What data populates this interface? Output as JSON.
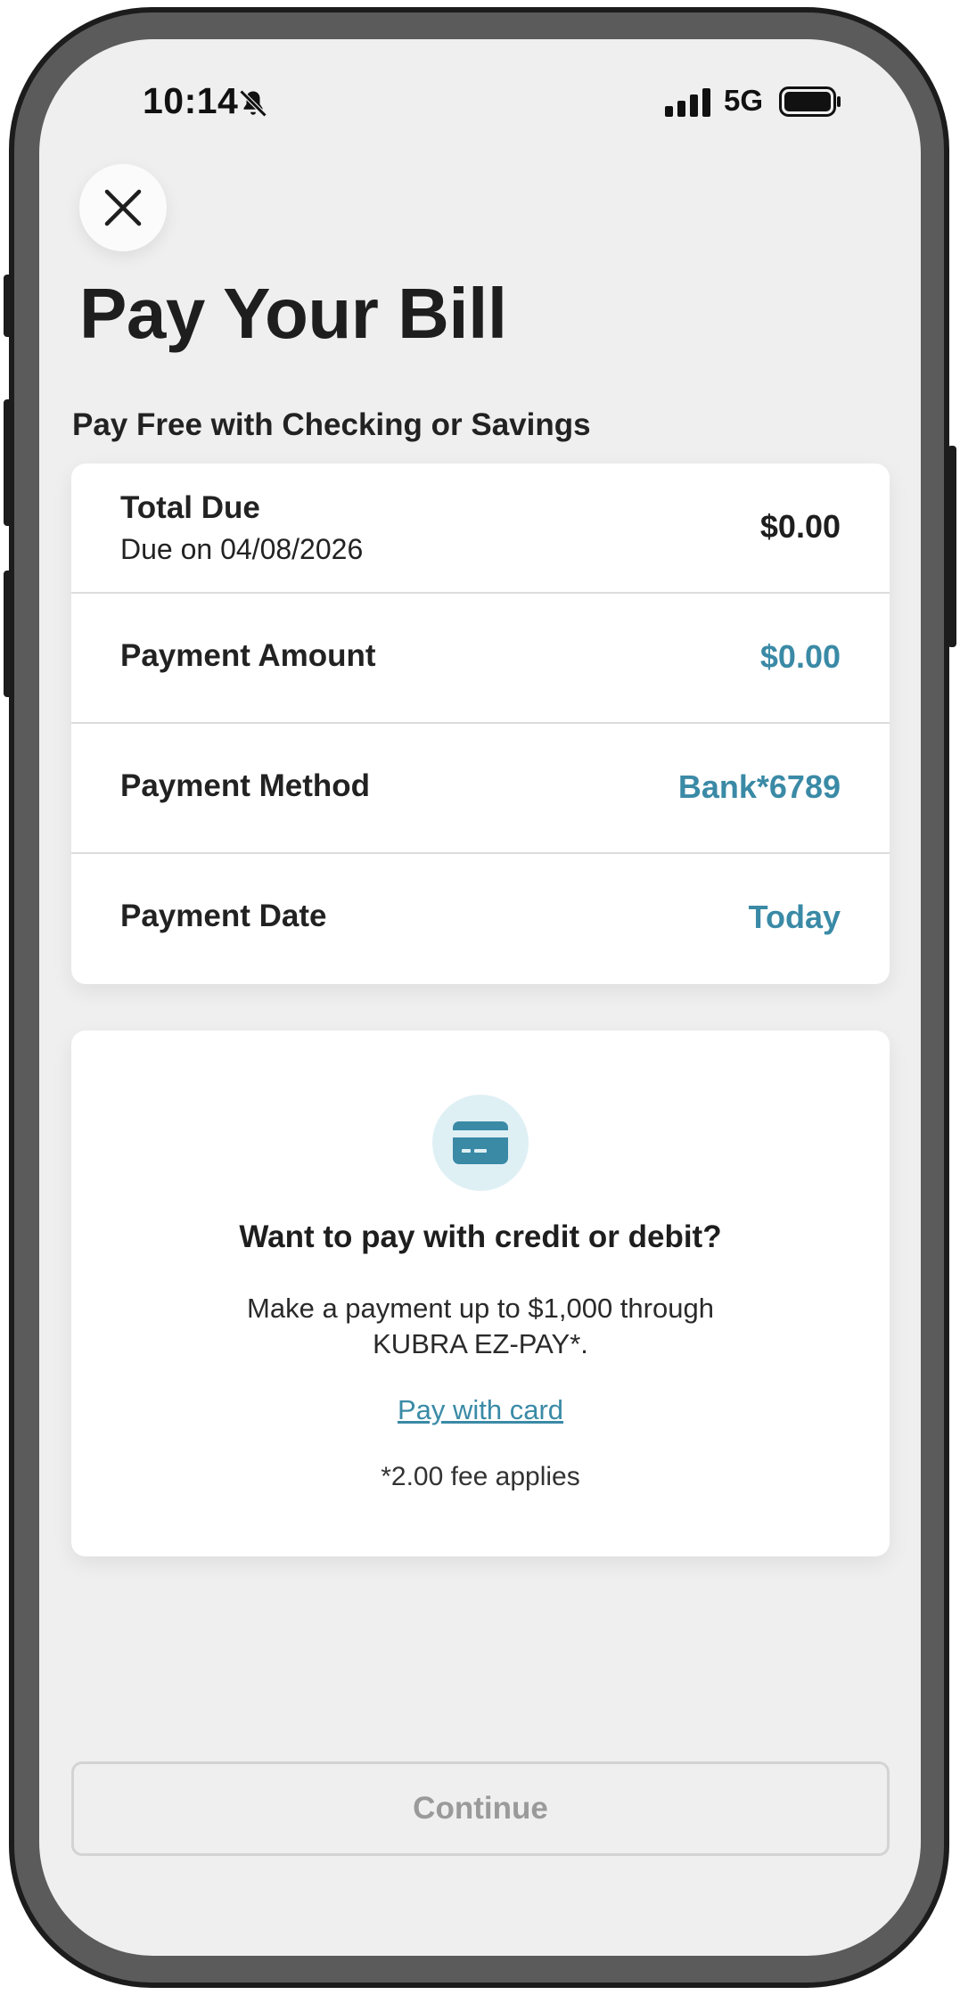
{
  "status_bar": {
    "time": "10:14",
    "network": "5G",
    "icons": [
      "bell-slash-icon",
      "signal-icon",
      "battery-icon"
    ]
  },
  "header": {
    "close_icon": "close-icon",
    "title": "Pay Your Bill"
  },
  "section": {
    "label": "Pay Free with Checking or Savings"
  },
  "summary": {
    "total_due_label": "Total Due",
    "due_date_text": "Due on 04/08/2026",
    "total_due_value": "$0.00",
    "rows": [
      {
        "label": "Payment Amount",
        "value": "$0.00"
      },
      {
        "label": "Payment Method",
        "value": "Bank*6789"
      },
      {
        "label": "Payment Date",
        "value": "Today"
      }
    ]
  },
  "card_promo": {
    "icon": "credit-card-icon",
    "title": "Want to pay with credit or debit?",
    "description": "Make a payment up to $1,000 through KUBRA EZ-PAY*.",
    "link_label": "Pay with card",
    "fee_note": "*2.00 fee applies"
  },
  "footer": {
    "continue_label": "Continue"
  },
  "colors": {
    "accent": "#3a8aa6",
    "background": "#efefef",
    "disabled_text": "#9a9a9a"
  }
}
